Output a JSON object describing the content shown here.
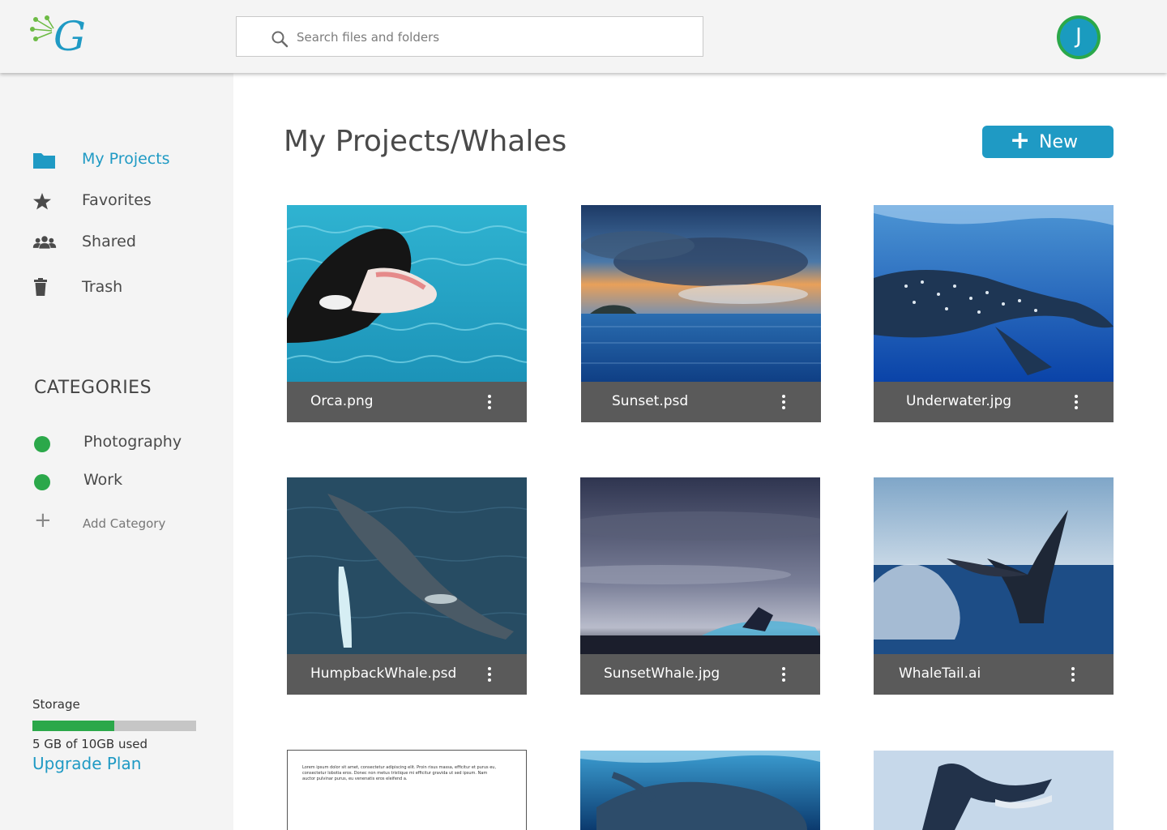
{
  "header": {
    "logo_letter": "G",
    "search": {
      "placeholder": "Search files and folders",
      "value": ""
    },
    "avatar_initial": "J"
  },
  "sidebar": {
    "nav": [
      {
        "label": "My Projects",
        "icon": "folder-icon",
        "active": true
      },
      {
        "label": "Favorites",
        "icon": "star-icon",
        "active": false
      },
      {
        "label": "Shared",
        "icon": "users-icon",
        "active": false
      },
      {
        "label": "Trash",
        "icon": "trash-icon",
        "active": false
      }
    ],
    "categories_title": "CATEGORIES",
    "categories": [
      {
        "label": "Photography",
        "color": "#2ba84a"
      },
      {
        "label": "Work",
        "color": "#2ba84a"
      }
    ],
    "add_category_label": "Add Category",
    "storage": {
      "label": "Storage",
      "used_text": "5 GB of 10GB used",
      "used_fraction": 0.5,
      "upgrade_label": "Upgrade Plan"
    }
  },
  "main": {
    "title": "My Projects/Whales",
    "new_button_label": "New",
    "files": [
      {
        "name": "Orca.png"
      },
      {
        "name": "Sunset.psd"
      },
      {
        "name": "Underwater.jpg"
      },
      {
        "name": "HumpbackWhale.psd"
      },
      {
        "name": "SunsetWhale.jpg"
      },
      {
        "name": "WhaleTail.ai"
      }
    ],
    "document_preview_text": "Lorem ipsum dolor sit amet, consectetur adipiscing elit. Proin risus massa, efficitur et purus eu, consectetur lobotia eros. Donec non metus tristique mi efficitur gravida ut sed ipsum. Nam auctor pulvinar purus, eu venenatis eros eleifend a."
  },
  "colors": {
    "accent": "#1f9ac4",
    "green": "#2ba84a",
    "card_bar": "#5a5a5a"
  }
}
